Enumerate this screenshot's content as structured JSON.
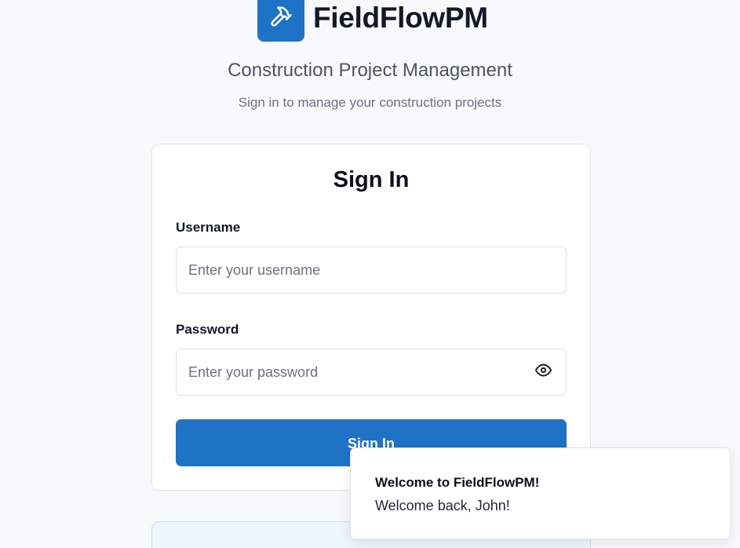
{
  "brand": {
    "name": "FieldFlowPM",
    "logo_icon": "hammer-icon",
    "accent_color": "#1f73c7"
  },
  "header": {
    "subtitle": "Construction Project Management",
    "tagline": "Sign in to manage your construction projects"
  },
  "login_form": {
    "title": "Sign In",
    "username": {
      "label": "Username",
      "placeholder": "Enter your username",
      "value": ""
    },
    "password": {
      "label": "Password",
      "placeholder": "Enter your password",
      "value": "",
      "toggle_icon": "eye-icon"
    },
    "submit_label": "Sign In"
  },
  "toast": {
    "title": "Welcome to FieldFlowPM!",
    "message": "Welcome back, John!"
  }
}
